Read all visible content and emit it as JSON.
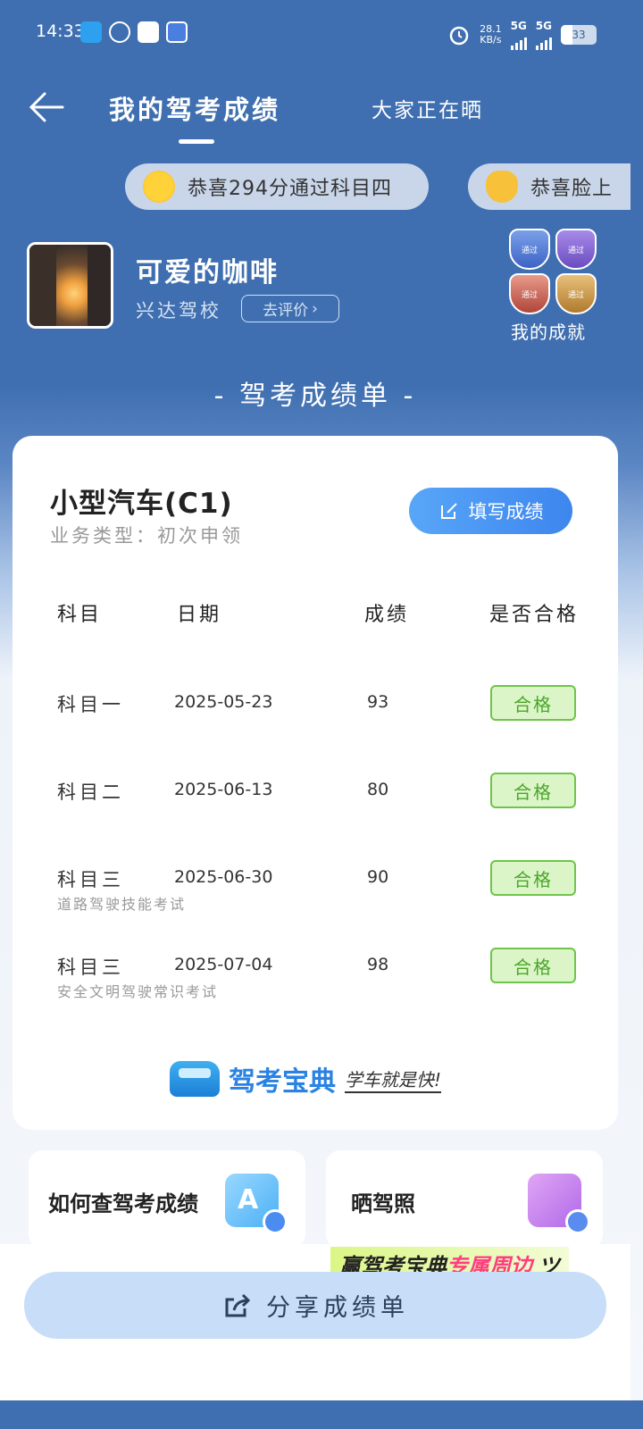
{
  "status_bar": {
    "time": "14:33",
    "net_speed_top": "28.1",
    "net_speed_unit": "KB/s",
    "signal1": "5G",
    "signal2": "5G",
    "battery": "33"
  },
  "header": {
    "tabs": [
      {
        "label": "我的驾考成绩",
        "active": true
      },
      {
        "label": "大家正在晒",
        "active": false
      }
    ]
  },
  "ticker": [
    {
      "icon": "star-struck-emoji-icon",
      "text": "恭喜294分通过科目四"
    },
    {
      "icon": "clapping-hands-emoji-icon",
      "text": "恭喜脸上"
    }
  ],
  "profile": {
    "nickname": "可爱的咖啡",
    "school": "兴达驾校",
    "review_button": "去评价",
    "achievements_label": "我的成就",
    "badge_text": "通过"
  },
  "section_title": "- 驾考成绩单 -",
  "card": {
    "vehicle_type": "小型汽车(C1)",
    "business_type": "业务类型：初次申领",
    "fill_button": "填写成绩",
    "columns": [
      "科目",
      "日期",
      "成绩",
      "是否合格"
    ],
    "rows": [
      {
        "subject": "科目一",
        "note": "",
        "date": "2025-05-23",
        "score": "93",
        "result": "合格"
      },
      {
        "subject": "科目二",
        "note": "",
        "date": "2025-06-13",
        "score": "80",
        "result": "合格"
      },
      {
        "subject": "科目三",
        "note": "道路驾驶技能考试",
        "date": "2025-06-30",
        "score": "90",
        "result": "合格"
      },
      {
        "subject": "科目三",
        "note": "安全文明驾驶常识考试",
        "date": "2025-07-04",
        "score": "98",
        "result": "合格"
      }
    ],
    "brand_name": "驾考宝典",
    "brand_slogan": "学车就是快!"
  },
  "tiles": [
    {
      "label": "如何查驾考成绩",
      "icon": "search-document-icon"
    },
    {
      "label": "晒驾照",
      "icon": "photo-camera-icon"
    }
  ],
  "promo": {
    "prefix": "赢驾考宝典",
    "highlight": "专属周边"
  },
  "share_button": "分享成绩单",
  "colors": {
    "header_bg": "#3f6fb0",
    "primary_blue": "#3d86ee",
    "pass_green": "#4aa62a",
    "share_bg": "#c7ddf8"
  }
}
